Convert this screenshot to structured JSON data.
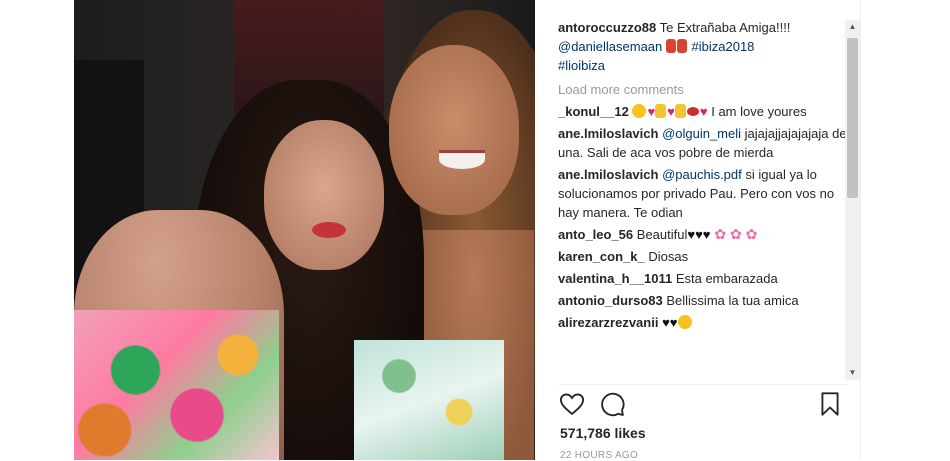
{
  "post": {
    "caption": {
      "user": "antoroccuzzo88",
      "text": " Te Extrañaba Amiga!!!!",
      "mention": "@daniellasemaan",
      "tag1": "#ibiza2018",
      "tag2": "#lioibiza"
    },
    "load_more": "Load more comments",
    "comments": [
      {
        "user": "_konul__12",
        "text": " I am love youres"
      },
      {
        "user": "ane.lmiloslavich",
        "mention": "@olguin_meli",
        "text": " jajajajjajajajaja de una. Sali de aca vos pobre de mierda"
      },
      {
        "user": "ane.lmiloslavich",
        "mention": "@pauchis.pdf",
        "text": " si igual ya lo solucionamos por privado Pau. Pero con vos no hay manera. Te odian"
      },
      {
        "user": "anto_leo_56",
        "text": " Beautiful"
      },
      {
        "user": "karen_con_k_",
        "text": " Diosas"
      },
      {
        "user": "valentina_h__1011",
        "text": " Esta embarazada"
      },
      {
        "user": "antonio_durso83",
        "text": " Bellissima la tua amica"
      },
      {
        "user": "alirezarzrezvanii",
        "text": ""
      }
    ],
    "likes": "571,786 likes",
    "time": "22 HOURS AGO"
  },
  "icons": {
    "like": "heart-outline-icon",
    "comment": "speech-bubble-icon",
    "save": "bookmark-icon"
  },
  "colors": {
    "link": "#003569",
    "muted": "#999999",
    "text": "#262626"
  }
}
